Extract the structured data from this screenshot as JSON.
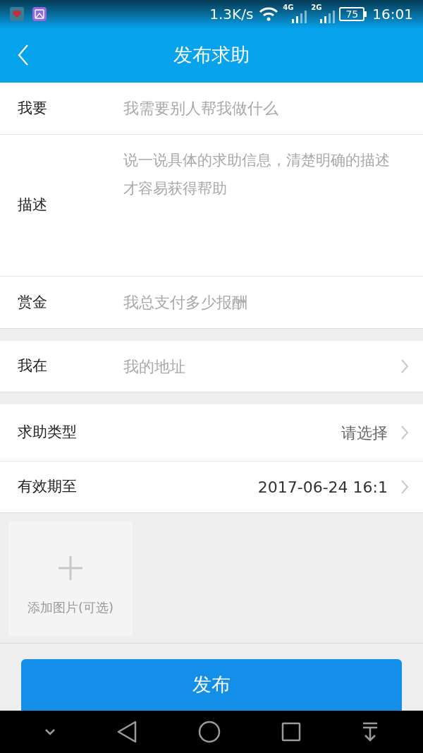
{
  "status_bar": {
    "network_speed": "1.3K/s",
    "network_4g": "4G",
    "network_2g": "2G",
    "battery": "75",
    "time": "16:01"
  },
  "header": {
    "title": "发布求助"
  },
  "sections": [
    {
      "rows": [
        {
          "kind": "input",
          "label": "我要",
          "placeholder": "我需要别人帮我做什么"
        },
        {
          "kind": "textarea",
          "label": "描述",
          "placeholder": "说一说具体的求助信息，清楚明确的描述才容易获得帮助"
        },
        {
          "kind": "input",
          "label": "赏金",
          "placeholder": "我总支付多少报酬"
        }
      ]
    },
    {
      "rows": [
        {
          "kind": "link",
          "label": "我在",
          "placeholder": "我的地址"
        }
      ]
    },
    {
      "rows": [
        {
          "kind": "picker",
          "label": "求助类型",
          "placeholder": "请选择"
        },
        {
          "kind": "picker",
          "label": "有效期至",
          "value": "2017-06-24 16:1"
        }
      ]
    }
  ],
  "photo": {
    "label": "添加图片(可选)"
  },
  "submit": {
    "label": "发布"
  }
}
